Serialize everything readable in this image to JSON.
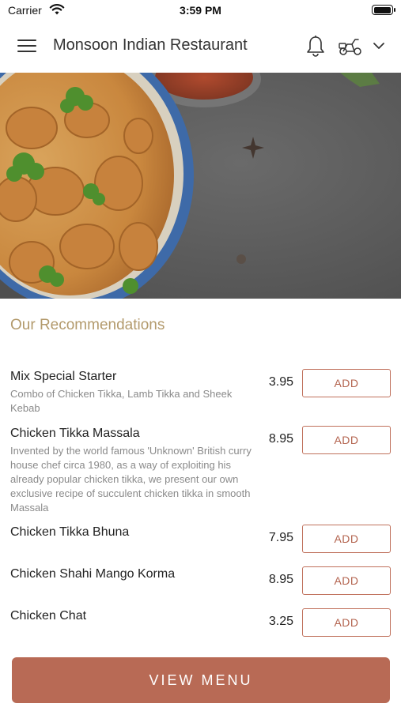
{
  "status_bar": {
    "carrier": "Carrier",
    "time": "3:59 PM"
  },
  "header": {
    "title": "Monsoon Indian Restaurant"
  },
  "icons": {
    "menu": "hamburger-menu-icon",
    "bell": "bell-icon",
    "delivery": "scooter-icon",
    "dropdown": "chevron-down-icon"
  },
  "colors": {
    "accent": "#b86a55",
    "section_title": "#b39a6c",
    "add_border": "#c0715c"
  },
  "recommendations": {
    "title": "Our Recommendations",
    "items": [
      {
        "name": "Mix Special Starter",
        "description": "Combo of Chicken Tikka, Lamb Tikka and Sheek Kebab",
        "price": "3.95",
        "add_label": "ADD"
      },
      {
        "name": "Chicken Tikka Massala",
        "description": "Invented by the world famous 'Unknown' British curry house chef circa 1980, as a way of exploiting his already popular chicken tikka, we present our own exclusive recipe of succulent chicken tikka in smooth Massala",
        "price": "8.95",
        "add_label": "ADD"
      },
      {
        "name": "Chicken Tikka Bhuna",
        "description": "",
        "price": "7.95",
        "add_label": "ADD"
      },
      {
        "name": "Chicken Shahi Mango Korma",
        "description": "",
        "price": "8.95",
        "add_label": "ADD"
      },
      {
        "name": "Chicken Chat",
        "description": "",
        "price": "3.25",
        "add_label": "ADD"
      }
    ]
  },
  "footer": {
    "view_menu_label": "VIEW MENU"
  }
}
